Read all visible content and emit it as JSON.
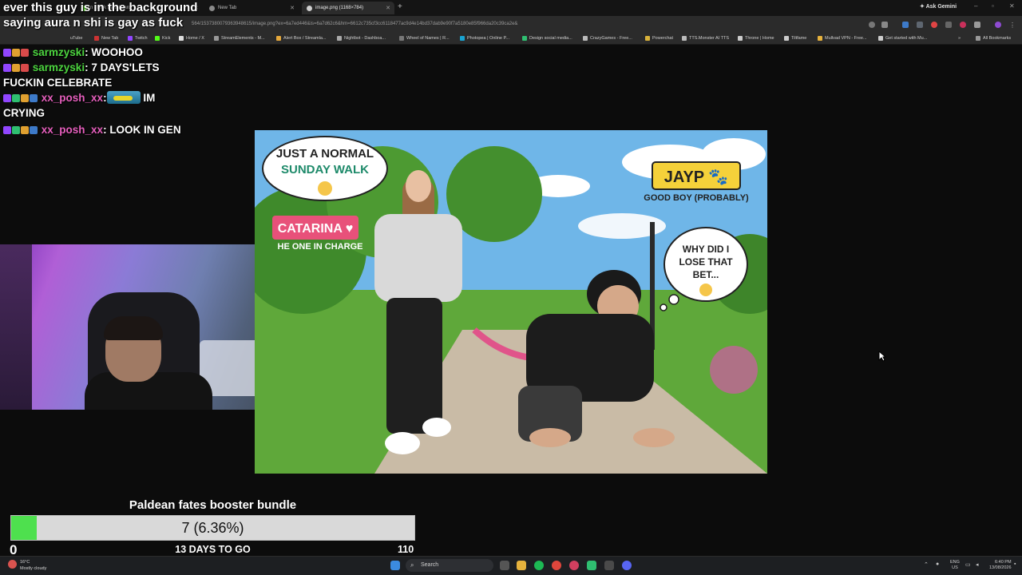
{
  "browser": {
    "tabs": [
      {
        "label": "n - Kick Dashboard",
        "active": false
      },
      {
        "label": "New Tab",
        "active": false
      },
      {
        "label": "image.png (1168×784)",
        "active": true
      }
    ],
    "ask_gemini": "Ask Gemini",
    "url": "564/1537380079363948615/image.png?ex=6a7ed446&is=6a7d62c6&hm=6612c735cf3cc6118477ac9d4e14bd37dab9e90f7a5180e85f966da20c39ca2e&",
    "bookmarks": [
      "uTube",
      "New Tab",
      "Twitch",
      "Kick",
      "Home / X",
      "StreamElements - M...",
      "Alert Box / Streamla...",
      "Nightbot - Dashboa...",
      "Wheel of Names | R...",
      "Photopea | Online P...",
      "Design social media...",
      "CrazyGames - Free...",
      "Powerchat",
      "TTS.Monster AI TTS",
      "Throne | Home",
      "Tiltfame",
      "Mullvad VPN - Free...",
      "Get started with Mu..."
    ],
    "all_bookmarks": "All Bookmarks"
  },
  "overlay": {
    "top_message": "ever this guy is in the background saying aura n shi is gay as fuck",
    "chat": [
      {
        "user": "sarmzyski",
        "user_color": "#4cd43f",
        "text": "WOOHOO",
        "emote": false
      },
      {
        "user": "sarmzyski",
        "user_color": "#4cd43f",
        "text": "7 DAYS'LETS FUCKIN CELEBRATE",
        "emote": false
      },
      {
        "user": "xx_posh_xx",
        "user_color": "#e65fbd",
        "text": "IM CRYING",
        "emote": true
      },
      {
        "user": "xx_posh_xx",
        "user_color": "#e65fbd",
        "text": "LOOK IN GEN",
        "emote": false
      }
    ]
  },
  "image": {
    "speech_left": "JUST A NORMAL",
    "speech_left_2": "SUNDAY WALK",
    "name_left": "CATARINA ♥",
    "caption_left": "HE ONE IN CHARGE",
    "name_right": "JAYP 🐾",
    "caption_right": "GOOD BOY (PROBABLY)",
    "thought_1": "WHY DID I",
    "thought_2": "LOSE THAT",
    "thought_3": "BET...",
    "sky_color": "#6fb6e8",
    "grass_color": "#5fa83a",
    "path_color": "#c9bba6"
  },
  "goal": {
    "title": "Paldean fates booster bundle",
    "current": 7,
    "max": 110,
    "fraction": 0.0636,
    "progress_text": "7 (6.36%)",
    "min_label": "0",
    "max_label": "110",
    "days_label": "13 DAYS TO GO",
    "fill_color": "#4ee04e"
  },
  "taskbar": {
    "weather_temp": "16°C",
    "weather_desc": "Mostly cloudy",
    "search": "Search",
    "lang_1": "ENG",
    "lang_2": "US",
    "time": "6:40 PM",
    "date": "13/08/2026"
  }
}
